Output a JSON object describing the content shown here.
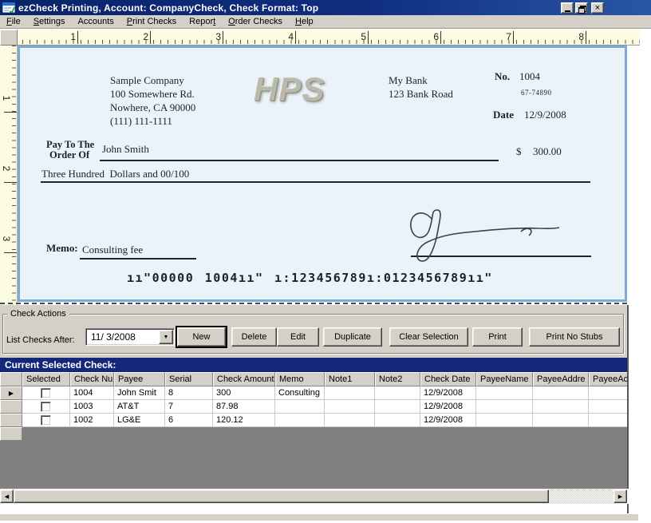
{
  "window": {
    "title": "ezCheck Printing, Account: CompanyCheck, Check Format: Top",
    "controls": [
      "minimize",
      "restore",
      "close"
    ]
  },
  "menu": {
    "items": [
      {
        "label": "File",
        "accel": 0
      },
      {
        "label": "Settings",
        "accel": 0
      },
      {
        "label": "Accounts",
        "accel": null
      },
      {
        "label": "Print Checks",
        "accel": 0
      },
      {
        "label": "Report",
        "accel": 5
      },
      {
        "label": "Order Checks",
        "accel": 0
      },
      {
        "label": "Help",
        "accel": 0
      }
    ]
  },
  "ruler": {
    "top_numbers": [
      "1",
      "2",
      "3",
      "4",
      "5",
      "6",
      "7",
      "8"
    ],
    "left_numbers": [
      "1",
      "2",
      "3"
    ]
  },
  "check": {
    "company": {
      "name": "Sample Company",
      "address1": "100 Somewhere Rd.",
      "address2": "Nowhere, CA 90000",
      "phone": "(111) 111-1111"
    },
    "watermark": "HPS",
    "bank": {
      "name": "My Bank",
      "address": "123 Bank Road"
    },
    "number_label": "No.",
    "number": "1004",
    "fraction": "67-74890",
    "date_label": "Date",
    "date": "12/9/2008",
    "payto_label_line1": "Pay To The",
    "payto_label_line2": "Order Of",
    "payee": "John Smith",
    "dollar_sign": "$",
    "amount": "300.00",
    "amount_words": "Three Hundred  Dollars and 00/100",
    "memo_label": "Memo:",
    "memo": "Consulting fee",
    "micr": "ıı\"00000 1004ıı\" ı:123456789ı:0123456789ıı\""
  },
  "actions": {
    "group_label": "Check Actions",
    "list_label": "List Checks After:",
    "date_value": "11/ 3/2008",
    "buttons": [
      {
        "label": "New",
        "default": true
      },
      {
        "label": "Delete",
        "default": false
      },
      {
        "label": "Edit",
        "default": false
      },
      {
        "label": "Duplicate",
        "default": false
      },
      {
        "label": "Clear Selection",
        "default": false
      },
      {
        "label": "Print",
        "default": false
      },
      {
        "label": "Print No Stubs",
        "default": false
      }
    ]
  },
  "selected_bar": {
    "label": "Current Selected Check:"
  },
  "grid": {
    "columns": [
      "Selected",
      "Check Nu",
      "Payee",
      "Serial Num",
      "Check Amount",
      "Memo",
      "Note1",
      "Note2",
      "Check Date",
      "PayeeName",
      "PayeeAddre",
      "PayeeAc"
    ],
    "rows": [
      {
        "current": true,
        "selected": false,
        "cells": [
          "1004",
          "John Smit",
          "8",
          "300",
          "Consulting",
          "",
          "",
          "12/9/2008",
          "",
          "",
          ""
        ]
      },
      {
        "current": false,
        "selected": false,
        "cells": [
          "1003",
          "AT&T",
          "7",
          "87.98",
          "",
          "",
          "",
          "12/9/2008",
          "",
          "",
          ""
        ]
      },
      {
        "current": false,
        "selected": false,
        "cells": [
          "1002",
          "LG&E",
          "6",
          "120.12",
          "",
          "",
          "",
          "12/9/2008",
          "",
          "",
          ""
        ]
      }
    ]
  },
  "colors": {
    "title_bar": "#0a246a",
    "panel": "#d4d0c8",
    "ruler_bg": "#fbfbe1",
    "check_bg": "#e9f3f9",
    "check_border": "#7fa8d4",
    "selected_bar_bg": "#14287b",
    "grid_empty_bg": "#808080"
  }
}
